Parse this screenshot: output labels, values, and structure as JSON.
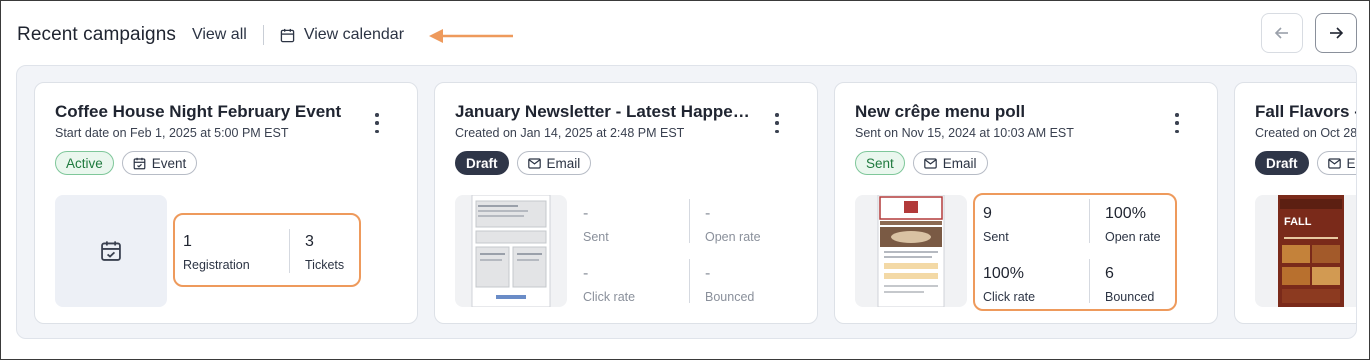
{
  "header": {
    "title": "Recent campaigns",
    "view_all": "View all",
    "view_calendar": "View calendar"
  },
  "colors": {
    "annotation": "#ee9a5c",
    "active_green": "#1f7a3e",
    "draft_dark": "#2f3648"
  },
  "cards": [
    {
      "title": "Coffee House Night February Event",
      "subtitle": "Start date on Feb 1, 2025 at 5:00 PM EST",
      "status": "Active",
      "type": "Event",
      "type_icon": "calendar-icon",
      "stats": [
        {
          "value": "1",
          "label": "Registration"
        },
        {
          "value": "3",
          "label": "Tickets"
        }
      ]
    },
    {
      "title": "January Newsletter - Latest Happe…",
      "subtitle": "Created on Jan 14, 2025 at 2:48 PM EST",
      "status": "Draft",
      "type": "Email",
      "type_icon": "mail-icon",
      "stats": [
        {
          "value": "-",
          "label": "Sent"
        },
        {
          "value": "-",
          "label": "Open rate"
        },
        {
          "value": "-",
          "label": "Click rate"
        },
        {
          "value": "-",
          "label": "Bounced"
        }
      ]
    },
    {
      "title": "New crêpe menu poll",
      "subtitle": "Sent on Nov 15, 2024 at 10:03 AM EST",
      "status": "Sent",
      "type": "Email",
      "type_icon": "mail-icon",
      "stats": [
        {
          "value": "9",
          "label": "Sent"
        },
        {
          "value": "100%",
          "label": "Open rate"
        },
        {
          "value": "100%",
          "label": "Click rate"
        },
        {
          "value": "6",
          "label": "Bounced"
        }
      ]
    },
    {
      "title": "Fall Flavors -",
      "subtitle": "Created on Oct 28",
      "status": "Draft",
      "type": "Em",
      "type_icon": "mail-icon",
      "thumb_text": "FALL"
    }
  ]
}
